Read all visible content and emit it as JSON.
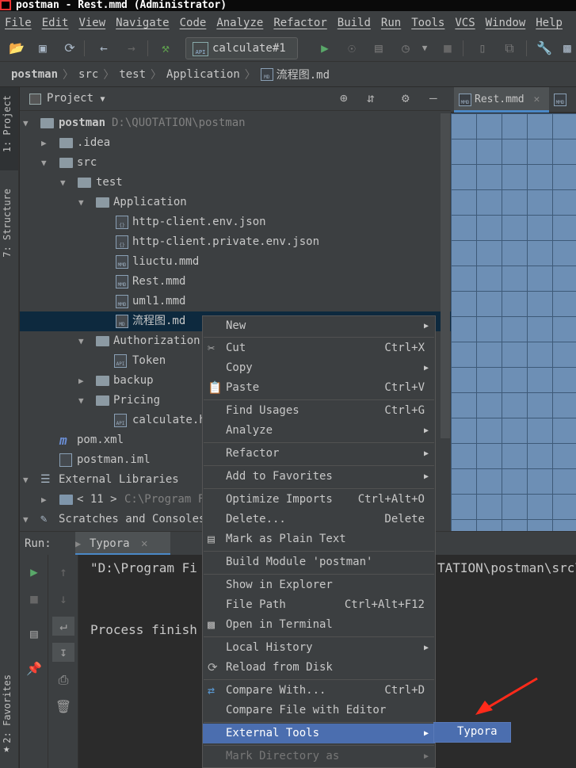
{
  "window": {
    "title": "postman - Rest.mmd (Administrator)"
  },
  "menubar": [
    "File",
    "Edit",
    "View",
    "Navigate",
    "Code",
    "Analyze",
    "Refactor",
    "Build",
    "Run",
    "Tools",
    "VCS",
    "Window",
    "Help"
  ],
  "toolbar": {
    "run_config": "calculate#1",
    "run_config_icon": "API"
  },
  "breadcrumb": [
    "postman",
    "src",
    "test",
    "Application",
    "流程图.md"
  ],
  "left_strip": {
    "project_tab": "1: Project",
    "structure_tab": "7: Structure",
    "favorites_tab": "2: Favorites"
  },
  "project_panel": {
    "title": "Project",
    "tree": [
      {
        "label": "postman",
        "hint": "D:\\QUOTATION\\postman",
        "icon": "folder"
      },
      {
        "label": ".idea",
        "icon": "folder"
      },
      {
        "label": "src",
        "icon": "folder"
      },
      {
        "label": "test",
        "icon": "folder"
      },
      {
        "label": "Application",
        "icon": "folder"
      },
      {
        "label": "http-client.env.json",
        "icon": "json-file"
      },
      {
        "label": "http-client.private.env.json",
        "icon": "json-file"
      },
      {
        "label": "liuctu.mmd",
        "icon": "mmd-file"
      },
      {
        "label": "Rest.mmd",
        "icon": "mmd-file"
      },
      {
        "label": "uml1.mmd",
        "icon": "mmd-file"
      },
      {
        "label": "流程图.md",
        "icon": "md-file"
      },
      {
        "label": "Authorization",
        "icon": "folder"
      },
      {
        "label": "Token",
        "icon": "api-file"
      },
      {
        "label": "backup",
        "icon": "folder"
      },
      {
        "label": "Pricing",
        "icon": "folder"
      },
      {
        "label": "calculate.h",
        "icon": "api-file"
      },
      {
        "label": "pom.xml",
        "icon": "maven-file"
      },
      {
        "label": "postman.iml",
        "icon": "iml-file"
      },
      {
        "label": "External Libraries",
        "icon": "library"
      },
      {
        "label": "< 11 >",
        "hint": "C:\\Program F",
        "icon": "jdk"
      },
      {
        "label": "Scratches and Consoles",
        "icon": "scratches"
      }
    ]
  },
  "editor": {
    "tabs": [
      "Rest.mmd",
      "MMD"
    ]
  },
  "run_panel": {
    "label": "Run:",
    "tab": "Typora",
    "console": [
      "\"D:\\Program Fi",
      "TATION\\postman\\src\\",
      "Process finish"
    ]
  },
  "context_menu": {
    "items": [
      {
        "label": "New",
        "submenu": true
      },
      {
        "label": "Cut",
        "shortcut": "Ctrl+X",
        "icon": "scissors-icon"
      },
      {
        "label": "Copy",
        "submenu": true
      },
      {
        "label": "Paste",
        "shortcut": "Ctrl+V",
        "icon": "clipboard-icon"
      },
      {
        "label": "Find Usages",
        "shortcut": "Ctrl+G"
      },
      {
        "label": "Analyze",
        "submenu": true
      },
      {
        "label": "Refactor",
        "submenu": true
      },
      {
        "label": "Add to Favorites",
        "submenu": true
      },
      {
        "label": "Optimize Imports",
        "shortcut": "Ctrl+Alt+O"
      },
      {
        "label": "Delete...",
        "shortcut": "Delete"
      },
      {
        "label": "Mark as Plain Text",
        "icon": "plain-text-icon"
      },
      {
        "label": "Build Module 'postman'"
      },
      {
        "label": "Show in Explorer"
      },
      {
        "label": "File Path",
        "shortcut": "Ctrl+Alt+F12"
      },
      {
        "label": "Open in Terminal",
        "icon": "terminal-icon"
      },
      {
        "label": "Local History",
        "submenu": true
      },
      {
        "label": "Reload from Disk",
        "icon": "reload-icon"
      },
      {
        "label": "Compare With...",
        "shortcut": "Ctrl+D",
        "icon": "compare-icon"
      },
      {
        "label": "Compare File with Editor"
      },
      {
        "label": "External Tools",
        "submenu": true,
        "highlighted": true
      },
      {
        "label": "Mark Directory as",
        "submenu": true,
        "disabled": true
      }
    ]
  },
  "submenu": {
    "items": [
      "Typora"
    ]
  },
  "colors": {
    "highlight": "#4b6eaf",
    "annotation_arrow": "#ff2a1a"
  }
}
